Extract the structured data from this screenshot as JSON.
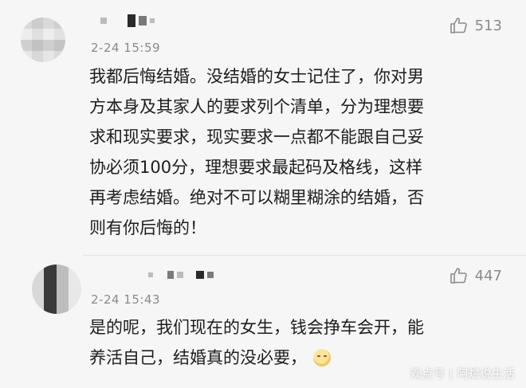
{
  "comments": [
    {
      "timestamp": "2-24 15:59",
      "likes": "513",
      "text": "我都后悔结婚。没结婚的女士记住了，你对男\n方本身及其家人的要求列个清单，分为理想要\n求和现实要求，现实要求一点都不能跟自己妥\n协必须100分，理想要求最起码及格线，这样\n再考虑结婚。绝对不可以糊里糊涂的结婚，否\n则有你后悔的！"
    },
    {
      "timestamp": "2-24 15:43",
      "likes": "447",
      "text": "是的呢，我们现在的女生，钱会挣车会开，能\n养活自己，结婚真的没必要，"
    }
  ],
  "watermark": "观点号 | 阿斌说生活",
  "icons": {
    "like": "thumbs-up-icon",
    "emoji": "smiling-face-emoji-icon"
  }
}
